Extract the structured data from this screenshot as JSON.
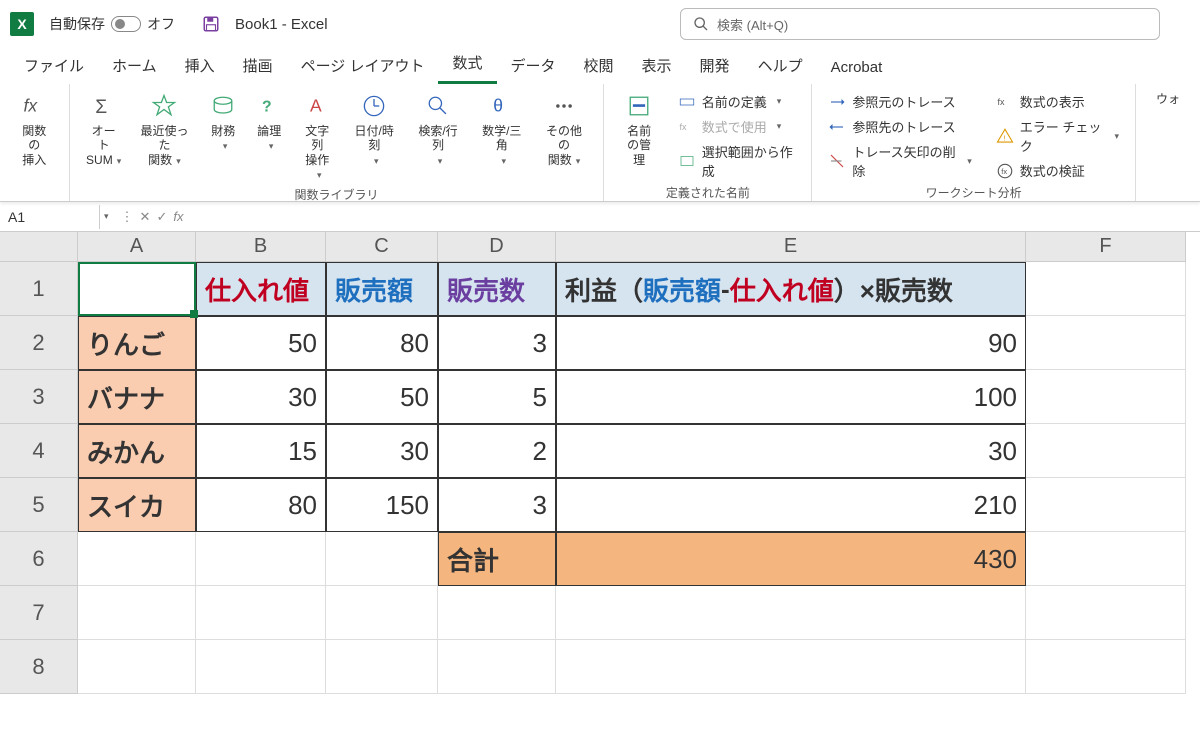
{
  "title_bar": {
    "autosave_label": "自動保存",
    "autosave_state": "オフ",
    "doc_title": "Book1  -  Excel",
    "search_placeholder": "検索 (Alt+Q)"
  },
  "tabs": {
    "file": "ファイル",
    "home": "ホーム",
    "insert": "挿入",
    "draw": "描画",
    "page_layout": "ページ レイアウト",
    "formulas": "数式",
    "data": "データ",
    "review": "校閲",
    "view": "表示",
    "developer": "開発",
    "help": "ヘルプ",
    "acrobat": "Acrobat"
  },
  "ribbon": {
    "insert_fn": "関数の\n挿入",
    "autosum": "オート\nSUM",
    "recent": "最近使った\n関数",
    "financial": "財務",
    "logical": "論理",
    "text": "文字列\n操作",
    "date": "日付/時刻",
    "lookup": "検索/行列",
    "math": "数学/三角",
    "other": "その他の\n関数",
    "lib_label": "関数ライブラリ",
    "name_mgr": "名前\nの管理",
    "define_name": "名前の定義",
    "use_in_formula": "数式で使用",
    "create_from_sel": "選択範囲から作成",
    "names_label": "定義された名前",
    "trace_prec": "参照元のトレース",
    "trace_dep": "参照先のトレース",
    "remove_arrows": "トレース矢印の削除",
    "show_formulas": "数式の表示",
    "error_check": "エラー チェック",
    "eval_formula": "数式の検証",
    "audit_label": "ワークシート分析",
    "watch": "ウォ"
  },
  "name_box": "A1",
  "chart_data": {
    "type": "table",
    "headers": {
      "b": "仕入れ値",
      "c": "販売額",
      "d": "販売数",
      "e_prefix": "利益（",
      "e_mid1": "販売額",
      "e_dash": "-",
      "e_mid2": "仕入れ値",
      "e_suffix": "）×販売数"
    },
    "rows": [
      {
        "name": "りんご",
        "cost": 50,
        "price": 80,
        "qty": 3,
        "profit": 90
      },
      {
        "name": "バナナ",
        "cost": 30,
        "price": 50,
        "qty": 5,
        "profit": 100
      },
      {
        "name": "みかん",
        "cost": 15,
        "price": 30,
        "qty": 2,
        "profit": 30
      },
      {
        "name": "スイカ",
        "cost": 80,
        "price": 150,
        "qty": 3,
        "profit": 210
      }
    ],
    "total_label": "合計",
    "total_value": 430
  }
}
